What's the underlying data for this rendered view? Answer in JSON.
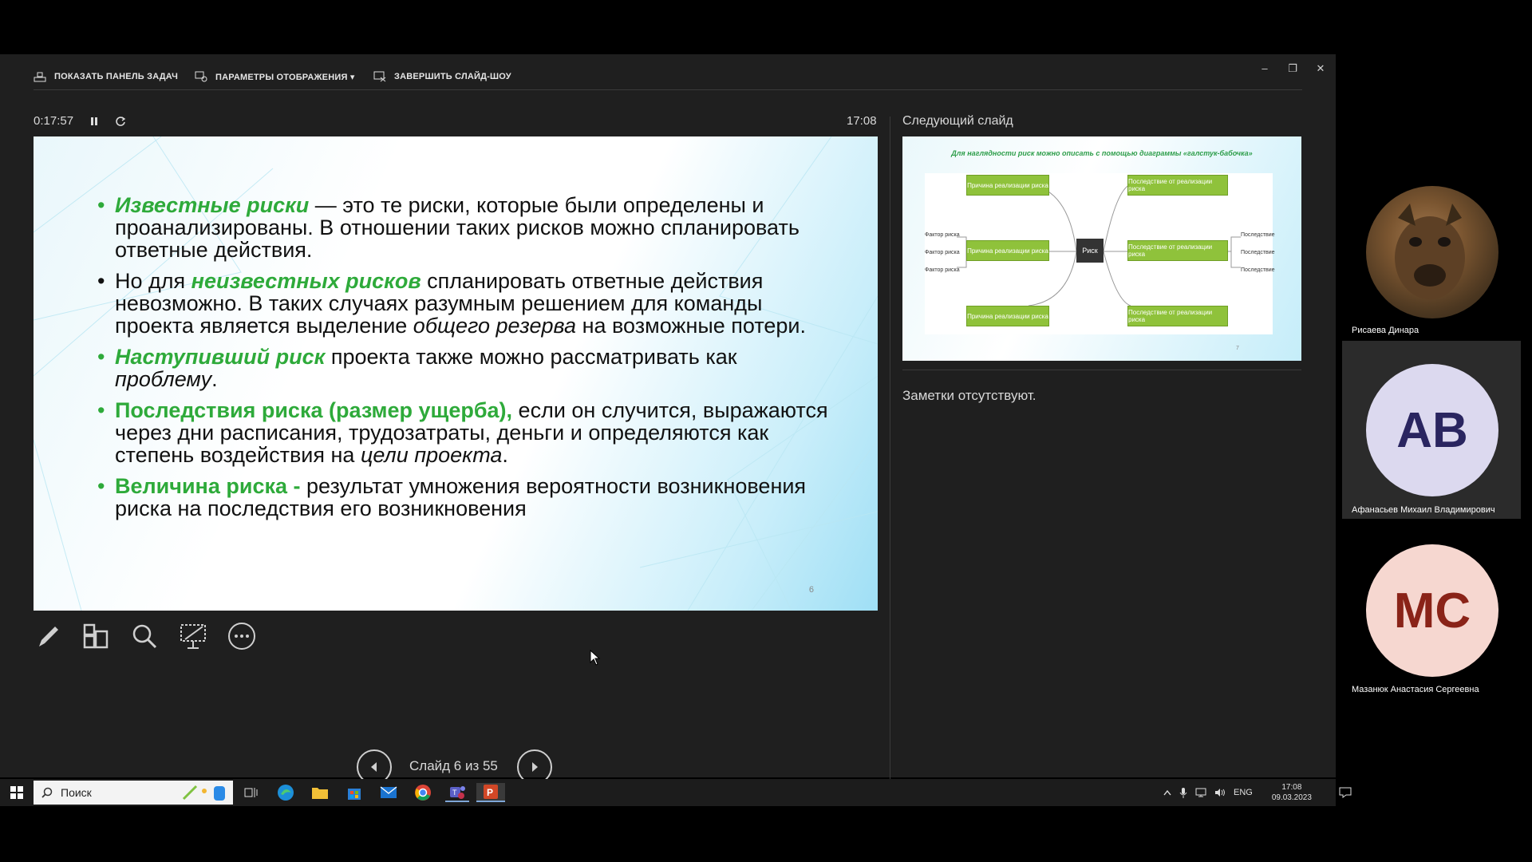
{
  "toolbar": {
    "show_taskbar": "ПОКАЗАТЬ ПАНЕЛЬ ЗАДАЧ",
    "display_settings": "ПАРАМЕТРЫ ОТОБРАЖЕНИЯ ▾",
    "end_show": "ЗАВЕРШИТЬ СЛАЙД-ШОУ"
  },
  "window_controls": {
    "minimize": "–",
    "restore": "❐",
    "close": "✕"
  },
  "timer": {
    "elapsed": "0:17:57",
    "pause_icon": "pause-icon",
    "reset_icon": "reset-icon"
  },
  "clock": "17:08",
  "next_slide": {
    "label": "Следующий слайд",
    "title": "Для наглядности риск можно описать с помощью диаграммы «галстук-бабочка»",
    "center": "Риск",
    "cause": "Причина реализации риска",
    "consequence": "Последствие от реализации риска",
    "factor": "Фактор риска",
    "result": "Последствие",
    "page_num": "7"
  },
  "notes": "Заметки отсутствуют.",
  "slide": {
    "b1_g": "Известные риски",
    "b1_t": " — это те риски, которые были определены и проанализированы. В отношении таких рисков можно спланировать ответные действия.",
    "b2_a": "Но для ",
    "b2_g": "неизвестных рисков",
    "b2_b": " спланировать ответные действия невозможно. В таких случаях разумным решением для команды проекта является выделение ",
    "b2_i": "общего резерва",
    "b2_c": " на возможные потери.",
    "b3_g": "Наступивший риск",
    "b3_t": " проекта также можно рассматривать как ",
    "b3_i": "проблему",
    "b3_e": ".",
    "b4_g": "Последствия риска (размер ущерба),",
    "b4_t": " если он случится, выражаются через дни расписания, трудозатраты, деньги и определяются как степень воздействия на ",
    "b4_i": "цели проекта",
    "b4_e": ".",
    "b5_g": "Величина риска -",
    "b5_t": " результат умножения вероятности возникновения риска на последствия его возникновения",
    "number": "6"
  },
  "nav": {
    "count": "Слайд 6 из 55"
  },
  "participants": [
    {
      "name": "Рисаева Динара",
      "initials": ""
    },
    {
      "name": "Афанасьев Михаил Владимирович",
      "initials": "АВ"
    },
    {
      "name": "Мазанюк Анастасия Сергеевна",
      "initials": "МС"
    }
  ],
  "colors": {
    "accent_green": "#2eaa3a",
    "av_bg": "#dcd9ef",
    "av_fg": "#2a2560",
    "mc_bg": "#f6d7d0",
    "mc_fg": "#8a2318"
  },
  "taskbar": {
    "search_placeholder": "Поиск",
    "lang": "ENG",
    "time": "17:08",
    "date": "09.03.2023"
  }
}
